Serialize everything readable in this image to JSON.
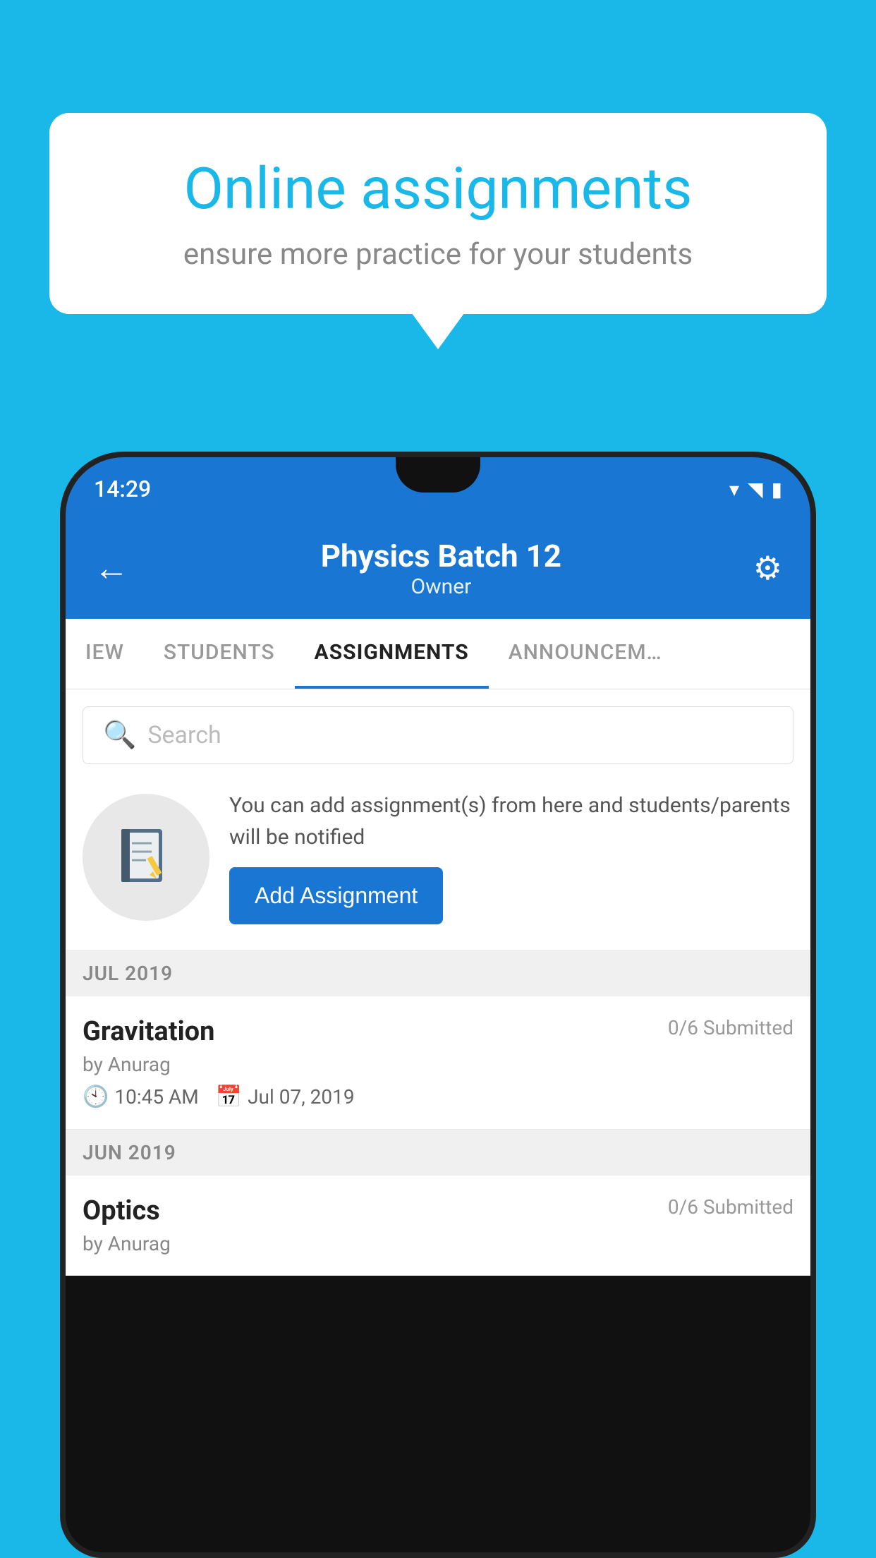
{
  "background_color": "#1ab8e8",
  "speech_bubble": {
    "title": "Online assignments",
    "subtitle": "ensure more practice for your students"
  },
  "phone": {
    "status_bar": {
      "time": "14:29",
      "icons": [
        "wifi",
        "signal",
        "battery"
      ]
    },
    "header": {
      "title": "Physics Batch 12",
      "subtitle": "Owner",
      "back_label": "←",
      "settings_label": "⚙"
    },
    "tabs": [
      {
        "label": "IEW",
        "active": false
      },
      {
        "label": "STUDENTS",
        "active": false
      },
      {
        "label": "ASSIGNMENTS",
        "active": true
      },
      {
        "label": "ANNOUNCEM…",
        "active": false
      }
    ],
    "search": {
      "placeholder": "Search"
    },
    "promo": {
      "text": "You can add assignment(s) from here and students/parents will be notified",
      "button_label": "Add Assignment"
    },
    "sections": [
      {
        "header": "JUL 2019",
        "assignments": [
          {
            "name": "Gravitation",
            "submitted": "0/6 Submitted",
            "author": "by Anurag",
            "time": "10:45 AM",
            "date": "Jul 07, 2019"
          }
        ]
      },
      {
        "header": "JUN 2019",
        "assignments": [
          {
            "name": "Optics",
            "submitted": "0/6 Submitted",
            "author": "by Anurag",
            "time": "",
            "date": ""
          }
        ]
      }
    ]
  }
}
